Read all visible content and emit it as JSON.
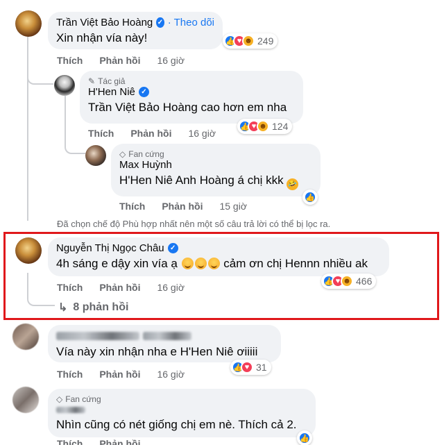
{
  "comments": [
    {
      "author": "Trần Việt Bảo Hoàng",
      "follow_label": "· Theo dõi",
      "text": "Xin nhận vía này!",
      "reaction_count": "249",
      "like_label": "Thích",
      "reply_label": "Phản hồi",
      "time": "16 giờ"
    },
    {
      "badge": "Tác giả",
      "author": "H'Hen Niê",
      "mention": "Trần Việt Bảo Hoàng",
      "text": " cao hơn em nha",
      "reaction_count": "124",
      "like_label": "Thích",
      "reply_label": "Phản hồi",
      "time": "16 giờ"
    },
    {
      "badge": "Fan cứng",
      "author": "Max Huỳnh",
      "mention": "H'Hen Niê",
      "text": " Anh Hoàng á chị kkk",
      "like_label": "Thích",
      "reply_label": "Phản hồi",
      "time": "15 giờ"
    },
    {
      "author": "Nguyễn Thị Ngọc Châu",
      "text_before": "4h sáng e dậy xin vía ạ",
      "text_after": " cảm ơn chị Hennn nhiều ak",
      "reaction_count": "466",
      "like_label": "Thích",
      "reply_label": "Phản hồi",
      "time": "16 giờ",
      "replies_label": "8 phản hồi"
    },
    {
      "text_before": "Vía này xin nhận nha e ",
      "mention": "H'Hen Niê",
      "text_after": " ơiiiii",
      "reaction_count": "31",
      "like_label": "Thích",
      "reply_label": "Phản hồi",
      "time": "16 giờ"
    },
    {
      "badge": "Fan cứng",
      "text": "Nhìn cũng có nét giống chị em nè. Thích cả 2.",
      "like_label": "Thích",
      "reply_label": "Phản hồi"
    }
  ],
  "filter_note": "Đã chọn chế độ Phù hợp nhất nên một số câu trả lời có thể bị lọc ra.",
  "colors": {
    "highlight": "#e0181b",
    "link": "#1877f2",
    "bubble": "#f0f2f5",
    "muted": "#65676b"
  },
  "icons": [
    "verified-badge-icon",
    "pencil-icon",
    "diamond-icon",
    "like-reaction-icon",
    "love-reaction-icon",
    "care-reaction-icon",
    "haha-reaction-icon",
    "reply-arrow-icon"
  ]
}
